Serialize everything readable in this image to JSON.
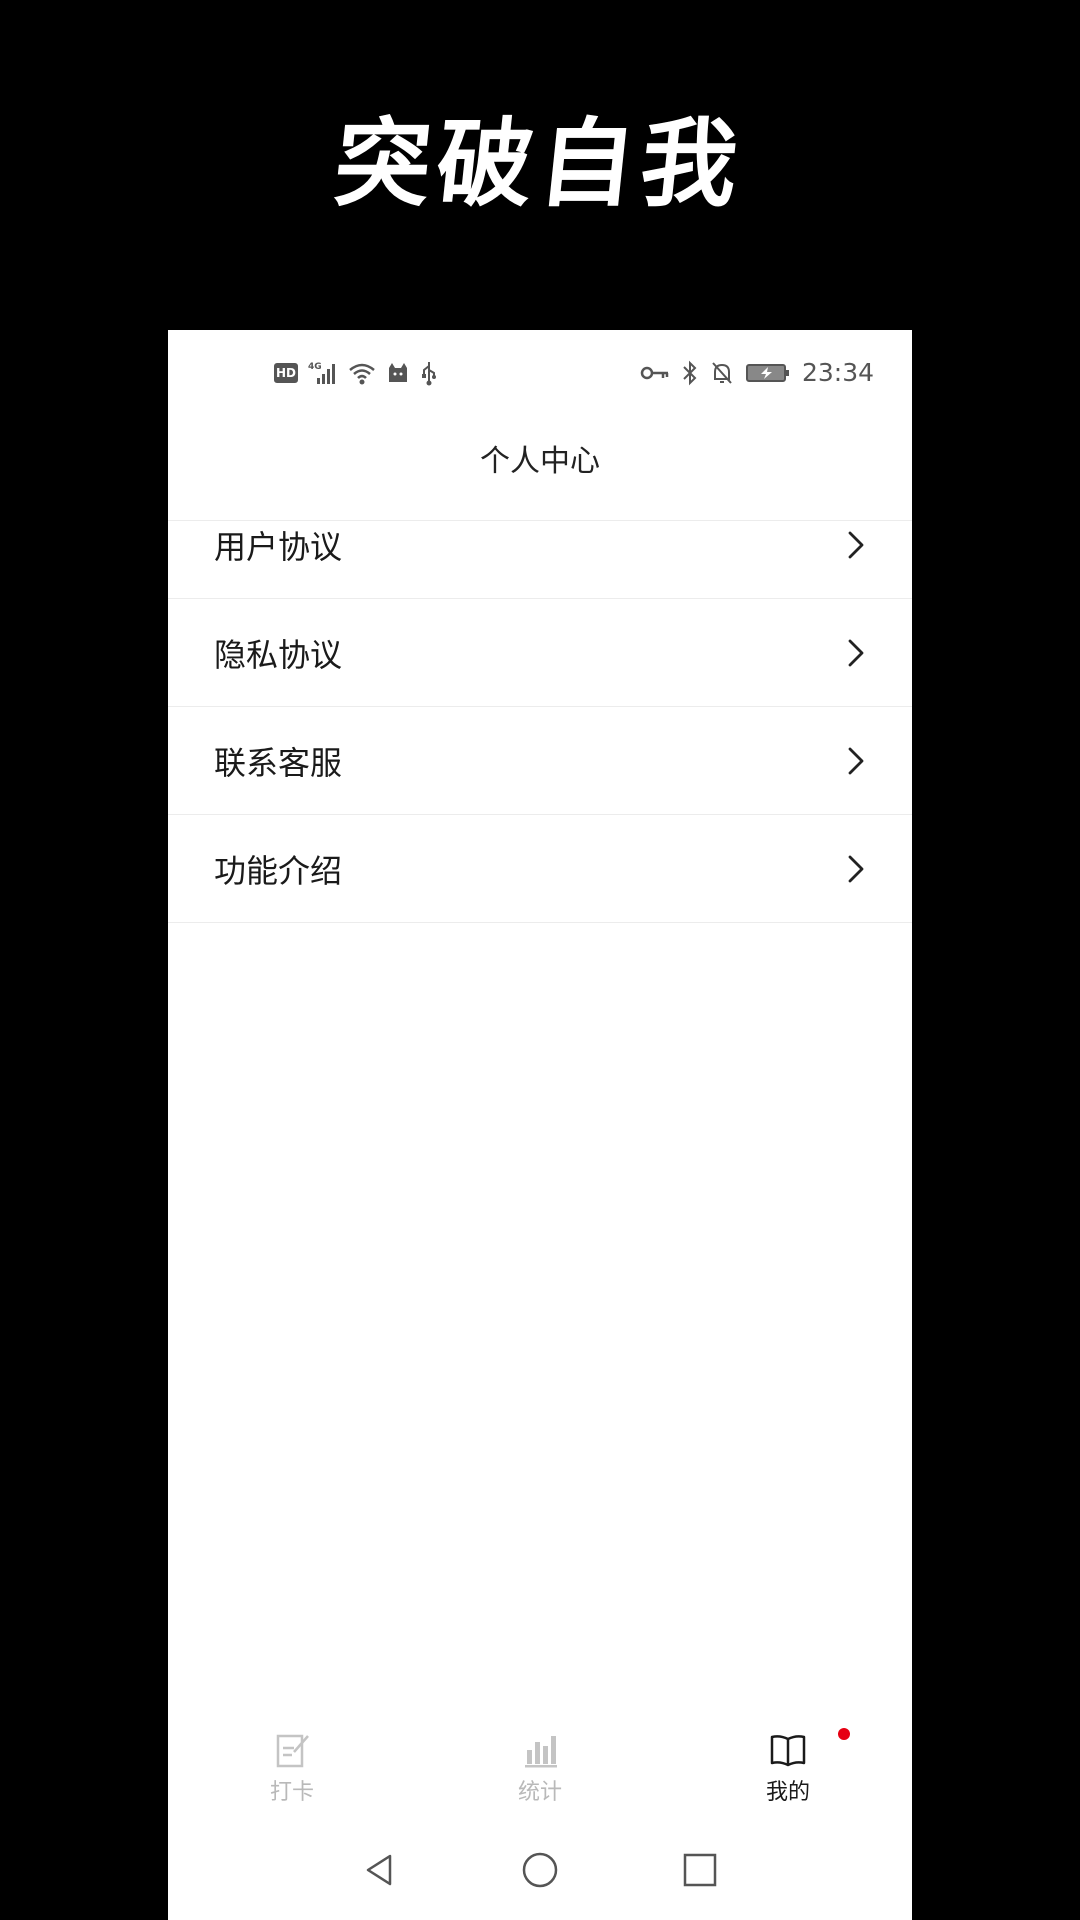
{
  "banner": {
    "title": "突破自我"
  },
  "status_bar": {
    "hd": "HD",
    "network": "4G",
    "time": "23:34",
    "left_icons": [
      "hd-icon",
      "signal-4g-icon",
      "wifi-icon",
      "cat-icon",
      "usb-icon"
    ],
    "right_icons": [
      "vpn-key-icon",
      "bluetooth-icon",
      "bell-off-icon",
      "battery-charging-icon"
    ]
  },
  "header": {
    "title": "个人中心"
  },
  "menu": {
    "items": [
      {
        "label": "用户协议"
      },
      {
        "label": "隐私协议"
      },
      {
        "label": "联系客服"
      },
      {
        "label": "功能介绍"
      }
    ]
  },
  "tabbar": {
    "tabs": [
      {
        "label": "打卡",
        "icon": "checkin-icon",
        "active": false
      },
      {
        "label": "统计",
        "icon": "stats-icon",
        "active": false
      },
      {
        "label": "我的",
        "icon": "book-icon",
        "active": true,
        "badge": true
      }
    ]
  },
  "colors": {
    "background": "#000000",
    "surface": "#ffffff",
    "divider": "#ececec",
    "text_primary": "#1a1a1a",
    "tab_inactive": "#b9b9b9",
    "badge": "#e60012"
  },
  "navbar": {
    "buttons": [
      "back-icon",
      "home-icon",
      "recents-icon"
    ]
  }
}
